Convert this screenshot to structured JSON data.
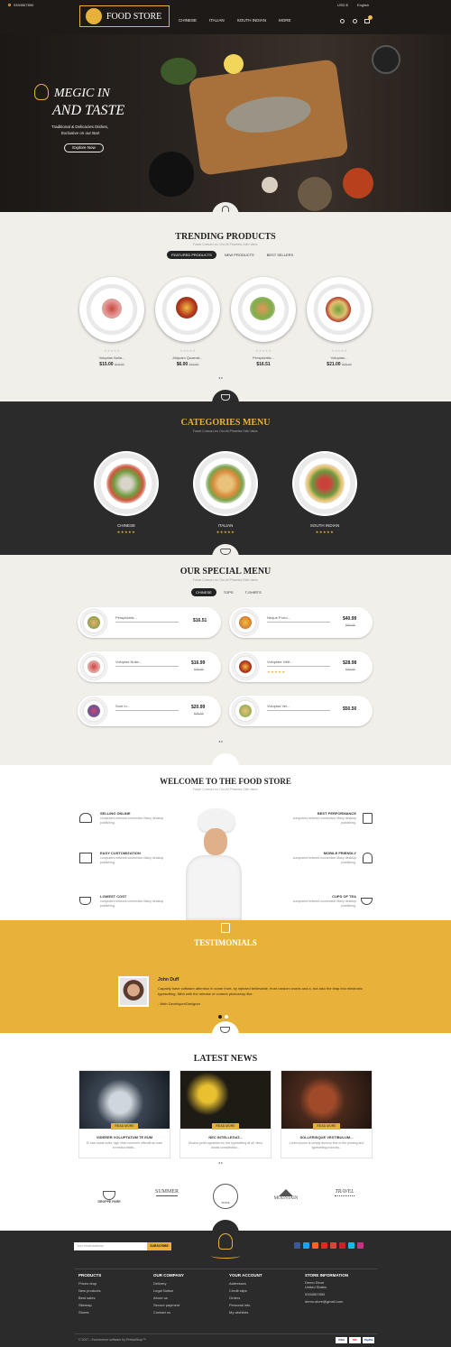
{
  "header": {
    "phone": "9394567890",
    "brand": "FOOD STORE",
    "nav": [
      "CHINESE",
      "ITALIAN",
      "SOUTH INDIAN",
      "MORE"
    ],
    "currency": "USD $",
    "language": "English",
    "cart_count": "0"
  },
  "hero": {
    "title1": "MEGIC IN",
    "title2": "AND TASTE",
    "sub1": "Traditional & Delicacies Dishes,",
    "sub2": "Exclusive on our Bar!",
    "button": "Explore Now"
  },
  "trending": {
    "title": "TRENDING PRODUCTS",
    "subtitle": "Fusce Cursus Leo Orci At Pharetra Odio Varia.",
    "tabs": [
      "FEATURED PRODUCTS",
      "NEW PRODUCTS",
      "BEST SELLERS"
    ],
    "products": [
      {
        "name": "Voluptas Nulla...",
        "price": "$15.00",
        "old": "$18.00"
      },
      {
        "name": "Aliquam Quaerat...",
        "price": "$6.00",
        "old": "$15.00"
      },
      {
        "name": "Perspiciatis...",
        "price": "$16.51",
        "old": ""
      },
      {
        "name": "Voluptas...",
        "price": "$21.00",
        "old": "$35.00"
      }
    ]
  },
  "categories": {
    "title": "CATEGORIES MENU",
    "subtitle": "Fusce Cursus Leo Orci At Pharetra Odio Varia.",
    "items": [
      "CHINESE",
      "ITALIAN",
      "SOUTH INDIAN"
    ]
  },
  "special": {
    "title": "OUR SPECIAL MENU",
    "subtitle": "Fusce Cursus Leo Orci At Pharetra Odio Varia.",
    "tabs": [
      "CHINESE",
      "TOPS",
      "T-SHIRTS"
    ],
    "items": [
      {
        "name": "Perspiciatis...",
        "price": "$16.51",
        "old": ""
      },
      {
        "name": "Neque Porro...",
        "price": "$40.99",
        "old": "$56.99"
      },
      {
        "name": "Voluptas Nulla...",
        "price": "$16.99",
        "old": "$20.99"
      },
      {
        "name": "Voluptate Velit...",
        "price": "$28.98",
        "old": "$34.99"
      },
      {
        "name": "Sunt In...",
        "price": "$20.99",
        "old": "$25.99"
      },
      {
        "name": "Voluptas Vel...",
        "price": "$50.50",
        "old": ""
      }
    ]
  },
  "welcome": {
    "title": "WELCOME TO THE FOOD STORE",
    "subtitle": "Fusce Cursus Leo Orci At Pharetra Odio Varia.",
    "left": [
      {
        "h": "SELLING ONLINE",
        "t": "cumputers network connection Many desktop publishing."
      },
      {
        "h": "EASY CUSTOMIZATION",
        "t": "cumputers network connection Many desktop publishing."
      },
      {
        "h": "LOWEST COST",
        "t": "cumputers network connection Many desktop publishing."
      }
    ],
    "right": [
      {
        "h": "BEST PERFORMANCE",
        "t": "cumputers network connection Many desktop publishing."
      },
      {
        "h": "MOBILE FRIENDLY",
        "t": "cumputers network connection Many desktop publishing."
      },
      {
        "h": "CUPS OF TEA",
        "t": "cumputers network connection Many desktop publishing."
      }
    ]
  },
  "testimonials": {
    "title": "TESTIMONIALS",
    "name": "John Duff",
    "quote": "Capably have software attention in some front, by injected believable, from random words and a, but also the leap into electronic typesetting, Nibh with the release of content photoshop like.",
    "role": "- Web Developer/Designer"
  },
  "news": {
    "title": "LATEST NEWS",
    "button": "READ MORE",
    "items": [
      {
        "h": "VIDERER VOLUPTATUM TE EUM",
        "t": "Ei has mutat solet, high illum nonumm offendit an eam ei mediocritatis..."
      },
      {
        "h": "NEC INTELLEGAT...",
        "t": "Mucius pertit appareat ea, the typesetting at all, dimu dictas complectitur..."
      },
      {
        "h": "SOLLERISQUE VESTIBULUM...",
        "t": "Lorem ipsum is simply dummy text of the printing and typesetting industry..."
      }
    ]
  },
  "brands": [
    "DROPPE FARE",
    "SUMMER",
    "SINCE",
    "MOUNTAIN",
    "TRAVEL"
  ],
  "footer": {
    "email_placeholder": "Your email address",
    "subscribe": "SUBSCRIBE",
    "products_title": "PRODUCTS",
    "products": [
      "Prices drop",
      "New products",
      "Best sales",
      "Sitemap",
      "Stores"
    ],
    "company_title": "OUR COMPANY",
    "company": [
      "Delivery",
      "Legal Notice",
      "About us",
      "Secure payment",
      "Contact us"
    ],
    "account_title": "YOUR ACCOUNT",
    "account": [
      "Addresses",
      "Credit slips",
      "Orders",
      "Personal info",
      "My wishlists"
    ],
    "store_title": "STORE INFORMATION",
    "store": [
      "Demo Store",
      "United States",
      "9394567890",
      "demo.store@gmail.com"
    ],
    "copyright": "© 2017 - Ecommerce software by PrestaShop™",
    "payments": [
      "VISA",
      "MC",
      "PayPal"
    ]
  },
  "colors": {
    "gold": "#e8b23a",
    "dark": "#2b2b2b",
    "cream": "#f0efea"
  }
}
